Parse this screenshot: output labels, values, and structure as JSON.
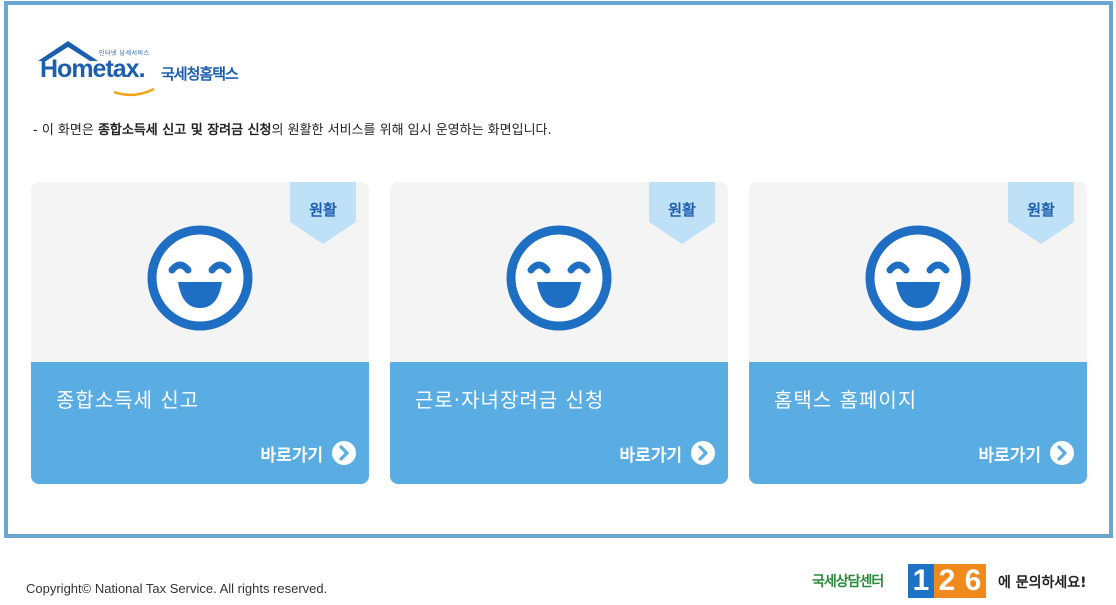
{
  "logo": {
    "slogan": "인터넷 납세서비스",
    "text": "Hometax.",
    "korean": "국세청홈택스"
  },
  "notice": {
    "prefix": "- 이 화면은 ",
    "bold": "종합소득세 신고 및 장려금 신청",
    "suffix": "의 원활한 서비스를 위해 임시 운영하는 화면입니다."
  },
  "cards": [
    {
      "badge": "원활",
      "title": "종합소득세 신고",
      "link": "바로가기"
    },
    {
      "badge": "원활",
      "title": "근로·자녀장려금 신청",
      "link": "바로가기"
    },
    {
      "badge": "원활",
      "title": "홈택스 홈페이지",
      "link": "바로가기"
    }
  ],
  "footer": {
    "copyright": "Copyright© National Tax Service. All rights reserved.",
    "callcenter_prefix": "국세상담센터",
    "callcenter_digits": [
      "1",
      "2",
      "6"
    ],
    "callcenter_suffix": "에 문의하세요!"
  },
  "colors": {
    "frame_border": "#6aa6cf",
    "card_blue": "#5aade2",
    "card_gray": "#f4f4f4",
    "badge_bg": "#bfe1f7",
    "brand_blue": "#1c5fae",
    "digit_colors": [
      "#1e73c8",
      "#f08a1c",
      "#f08a1c"
    ]
  },
  "icons": {
    "status": "smiley-face-icon",
    "go": "chevron-right-circle-icon",
    "logo": "house-roof-icon"
  }
}
